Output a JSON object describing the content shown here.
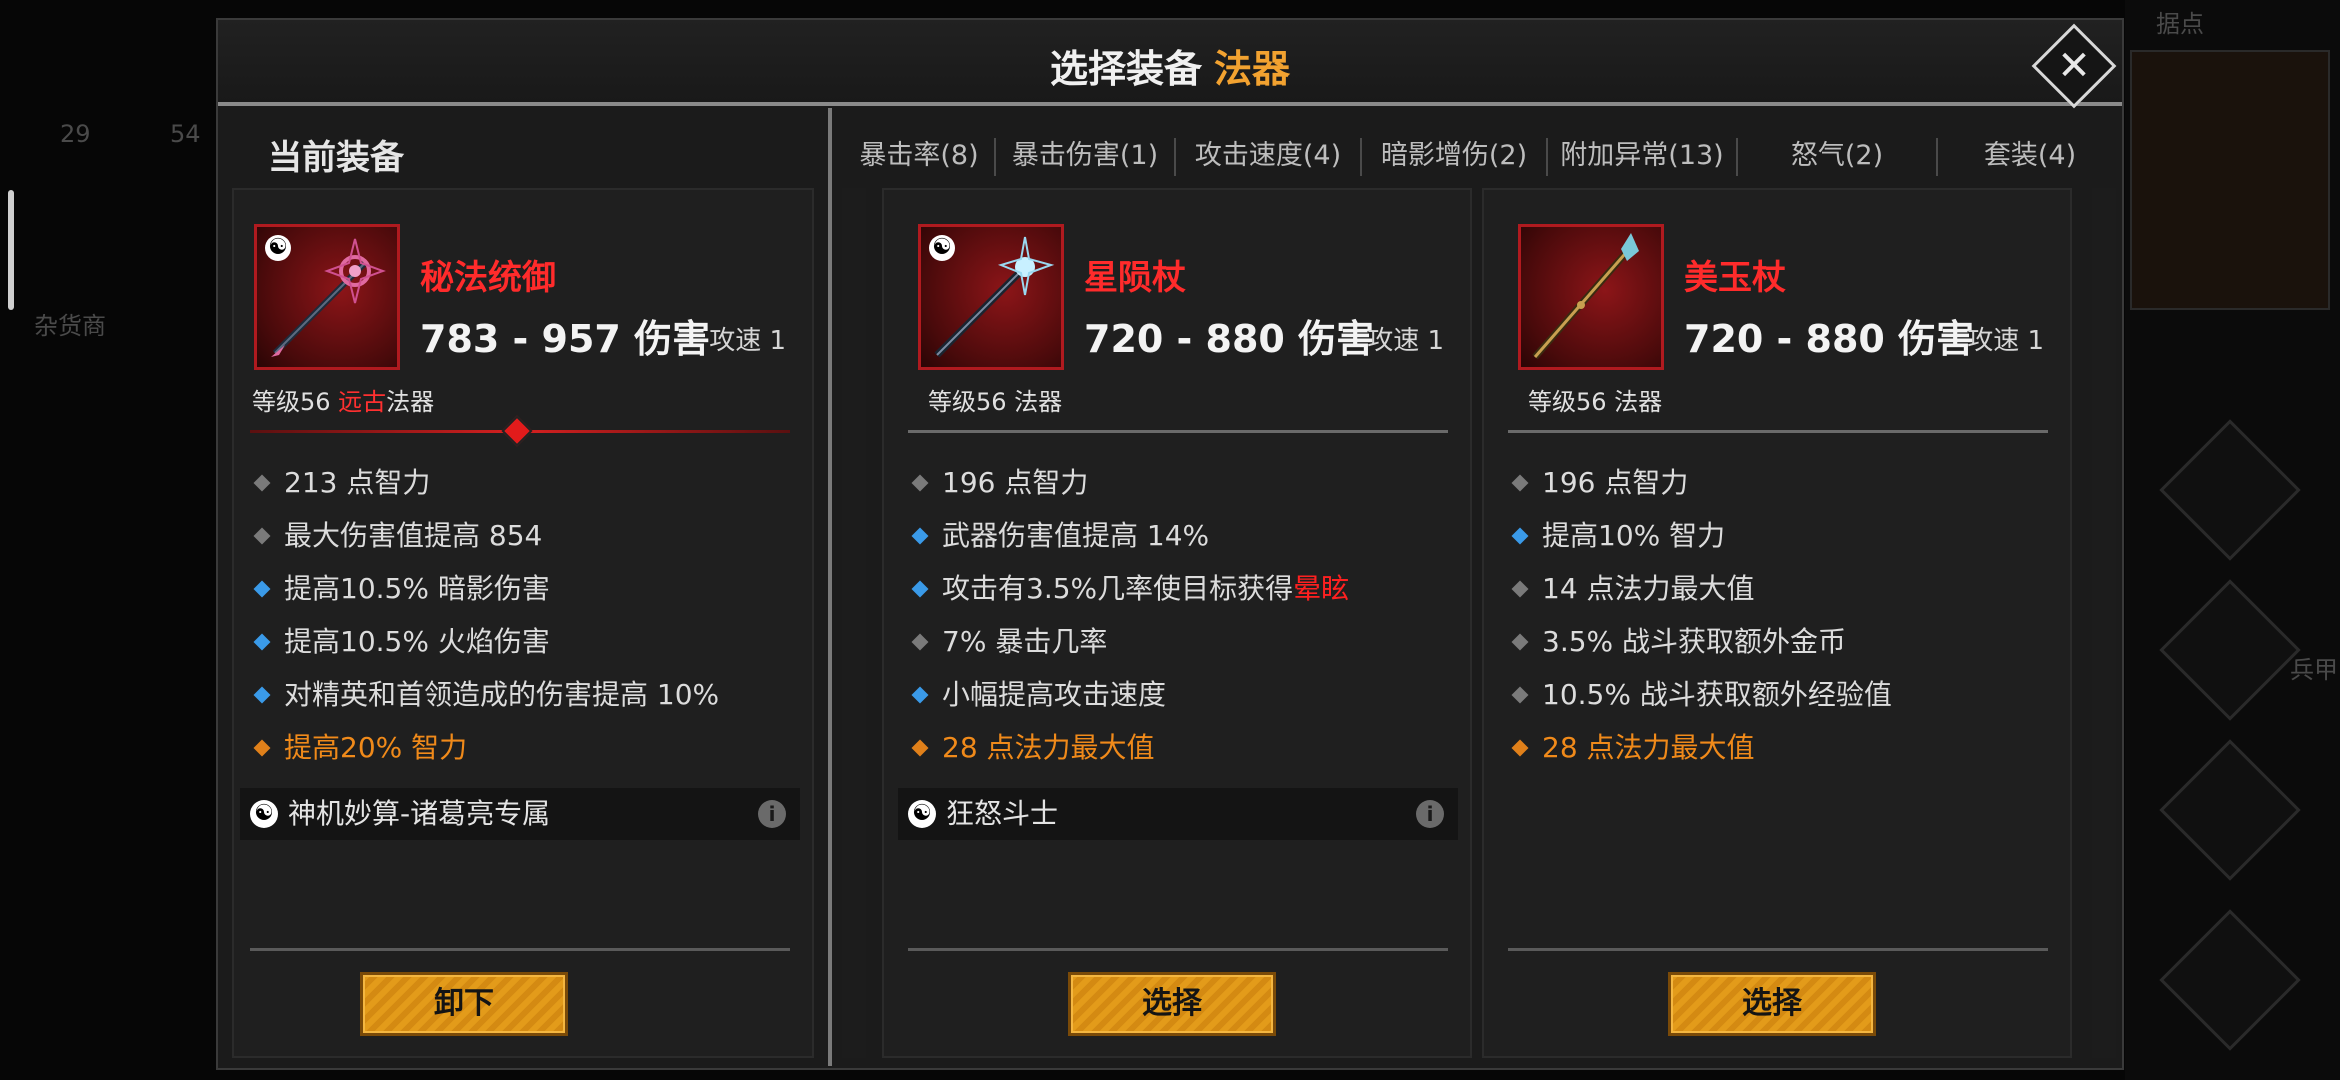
{
  "background": {
    "left_numbers": [
      "29",
      "54"
    ],
    "left_label": "杂货商",
    "top_right_label": "据点",
    "right_label": "兵甲"
  },
  "modal": {
    "title": "选择装备",
    "title_accent": "法器",
    "close_icon": "close-icon"
  },
  "current_section_label": "当前装备",
  "tabs": [
    {
      "label": "暴击率(8)"
    },
    {
      "label": "暴击伤害(1)"
    },
    {
      "label": "攻击速度(4)"
    },
    {
      "label": "暗影增伤(2)"
    },
    {
      "label": "附加异常(13)"
    },
    {
      "label": "怒气(2)"
    },
    {
      "label": "套装(4)"
    }
  ],
  "current_item": {
    "name": "秘法统御",
    "damage": "783 - 957 伤害",
    "speed": "攻速 1",
    "level_prefix": "等级56 ",
    "rarity": "远古",
    "type": "法器",
    "stats": [
      {
        "text": "213 点智力",
        "bullet": "gray"
      },
      {
        "text": "最大伤害值提高 854",
        "bullet": "gray"
      },
      {
        "text": "提高10.5% 暗影伤害",
        "bullet": "blue"
      },
      {
        "text": "提高10.5% 火焰伤害",
        "bullet": "blue"
      },
      {
        "text": "对精英和首领造成的伤害提高 10%",
        "bullet": "blue"
      },
      {
        "text": "提高20% 智力",
        "bullet": "orange"
      }
    ],
    "set_name": "神机妙算-诸葛亮专属",
    "button": "卸下"
  },
  "candidates": [
    {
      "name": "星陨杖",
      "damage": "720 - 880 伤害",
      "speed": "攻速 1",
      "level": "等级56 法器",
      "stats_plain": [
        {
          "text": "196 点智力",
          "bullet": "gray"
        },
        {
          "text": "武器伤害值提高 14%",
          "bullet": "blue"
        }
      ],
      "stat_stun_prefix": "攻击有3.5%几率使目标获得",
      "stat_stun_word": "晕眩",
      "stats_rest": [
        {
          "text": "7% 暴击几率",
          "bullet": "gray"
        },
        {
          "text": "小幅提高攻击速度",
          "bullet": "blue"
        },
        {
          "text": "28 点法力最大值",
          "bullet": "orange"
        }
      ],
      "set_name": "狂怒斗士",
      "button": "选择"
    },
    {
      "name": "美玉杖",
      "damage": "720 - 880 伤害",
      "speed": "攻速 1",
      "level": "等级56 法器",
      "stats": [
        {
          "text": "196 点智力",
          "bullet": "gray"
        },
        {
          "text": "提高10% 智力",
          "bullet": "blue"
        },
        {
          "text": "14 点法力最大值",
          "bullet": "gray"
        },
        {
          "text": "3.5% 战斗获取额外金币",
          "bullet": "gray"
        },
        {
          "text": "10.5% 战斗获取额外经验值",
          "bullet": "gray"
        },
        {
          "text": "28 点法力最大值",
          "bullet": "orange"
        }
      ],
      "button": "选择"
    }
  ]
}
